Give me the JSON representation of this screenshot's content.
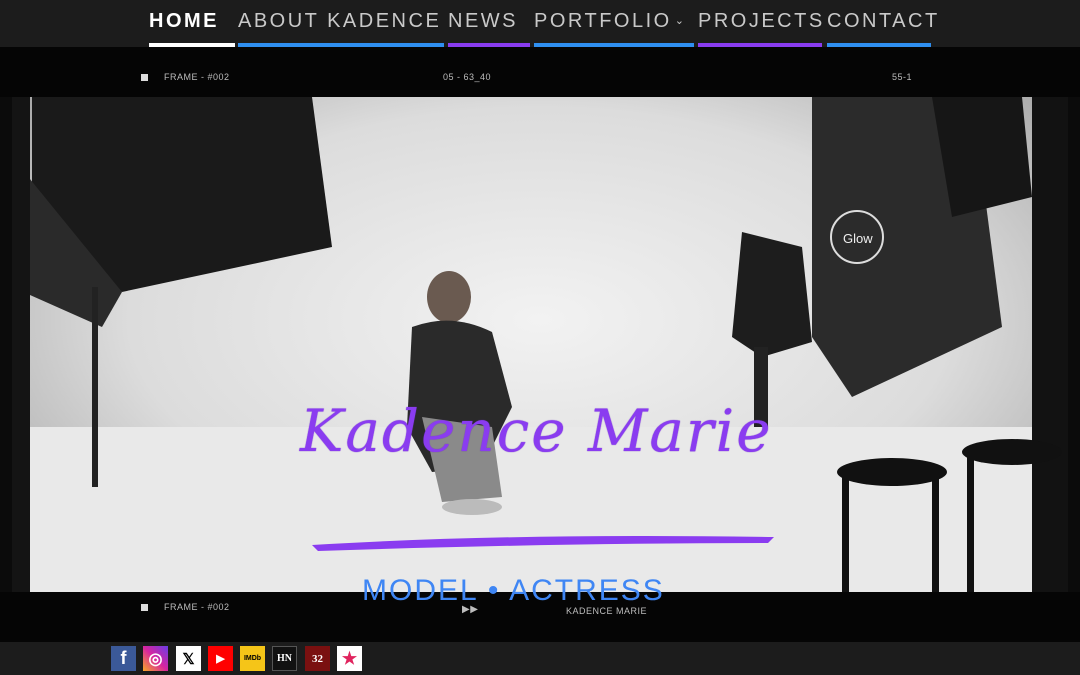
{
  "nav": {
    "items": [
      {
        "label": "HOME",
        "underline": "#ffffff"
      },
      {
        "label": "ABOUT KADENCE",
        "underline": "#2f8ff0"
      },
      {
        "label": "NEWS",
        "underline": "#8a3cf0"
      },
      {
        "label": "PORTFOLIO",
        "underline": "#2f8ff0"
      },
      {
        "label": "PROJECTS",
        "underline": "#8a3cf0"
      },
      {
        "label": "CONTACT",
        "underline": "#2f8ff0"
      }
    ]
  },
  "hero": {
    "top_frame_label": "FRAME - #002",
    "timecode": "05 - 63_40",
    "clip_id": "55-1",
    "bottom_frame_label": "FRAME - #002",
    "play_glyph": "▶▶",
    "bottom_name": "KADENCE MARIE",
    "softbox_brand": "Glow",
    "title": "Kadence Marie",
    "subtitle": "MODEL • ACTRESS"
  },
  "footer": {
    "socials": [
      {
        "name": "facebook-icon",
        "glyph": "f",
        "color": "#3b5998"
      },
      {
        "name": "instagram-icon",
        "glyph": "◎",
        "color": "#d6249f"
      },
      {
        "name": "x-icon",
        "glyph": "𝕏",
        "color": "#000000"
      },
      {
        "name": "youtube-icon",
        "glyph": "▶",
        "color": "#ff0000"
      },
      {
        "name": "imdb-icon",
        "glyph": "IMDb",
        "color": "#f5c518"
      },
      {
        "name": "hn-icon",
        "glyph": "HN",
        "color": "#111111"
      },
      {
        "name": "stage32-icon",
        "glyph": "32",
        "color": "#7a1010"
      },
      {
        "name": "star-icon",
        "glyph": "★",
        "color": "#ffffff"
      }
    ]
  },
  "colors": {
    "accent_purple": "#8a3cf0",
    "accent_blue": "#2f8ff0"
  }
}
